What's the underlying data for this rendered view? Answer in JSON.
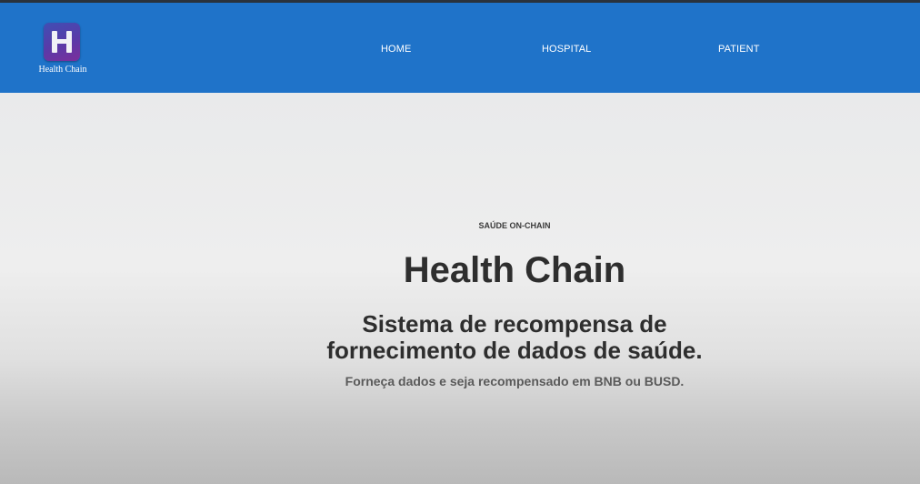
{
  "brand": {
    "name": "Health Chain",
    "logo_icon": "h-letter-logo-icon"
  },
  "nav": {
    "items": [
      {
        "label": "HOME"
      },
      {
        "label": "HOSPITAL"
      },
      {
        "label": "PATIENT"
      }
    ]
  },
  "hero": {
    "eyebrow": "SAÚDE ON-CHAIN",
    "title": "Health Chain",
    "subtitle_line1": "Sistema de recompensa de",
    "subtitle_line2": "fornecimento de dados de saúde.",
    "tagline": "Forneça dados e seja recompensado em BNB ou BUSD."
  },
  "colors": {
    "navbar": "#1f73c9",
    "logo_gradient_start": "#3f4fb4",
    "logo_gradient_end": "#7b2f9c",
    "heading_text": "#2e2e2e",
    "tagline_text": "#5a5a5a"
  }
}
